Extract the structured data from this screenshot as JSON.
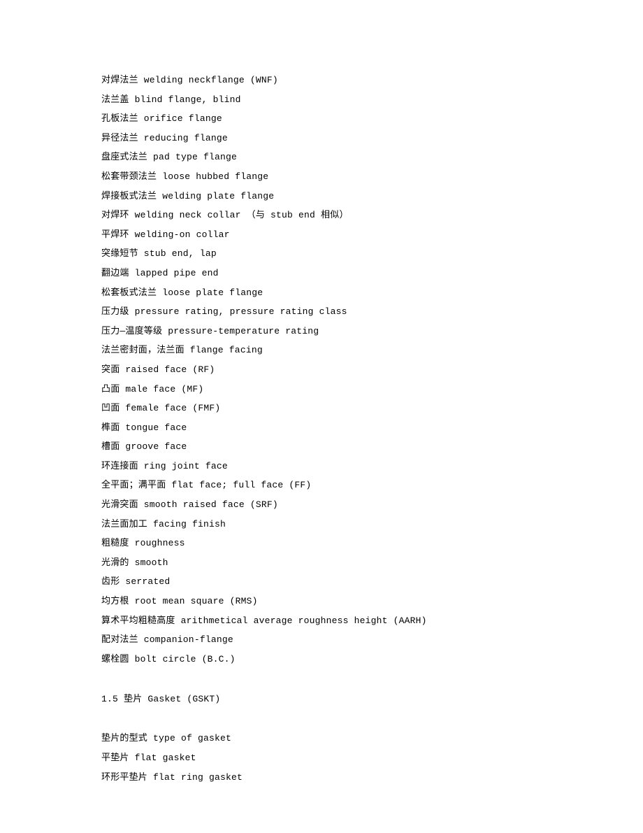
{
  "lines": [
    "对焊法兰 welding neckflange (WNF)",
    "法兰盖 blind flange, blind",
    "孔板法兰 orifice flange",
    "异径法兰 reducing flange",
    "盘座式法兰 pad type flange",
    "松套带颈法兰 loose hubbed flange",
    "焊接板式法兰 welding plate flange",
    "对焊环 welding neck collar （与 stub end 相似）",
    "平焊环 welding-on collar",
    "突缘短节 stub end, lap",
    "翻边端 lapped pipe end",
    "松套板式法兰 loose plate flange",
    "压力级 pressure rating, pressure rating class",
    "压力—温度等级 pressure-temperature rating",
    "法兰密封面，法兰面 flange facing",
    "突面 raised face (RF)",
    "凸面 male face (MF)",
    "凹面 female face (FMF)",
    "榫面 tongue face",
    "槽面 groove face",
    "环连接面 ring joint face",
    "全平面；满平面 flat face; full face (FF)",
    "光滑突面 smooth raised face (SRF)",
    "法兰面加工 facing finish",
    "粗糙度 roughness",
    "光滑的 smooth",
    "齿形 serrated",
    "均方根 root mean square (RMS)",
    "算术平均粗糙高度 arithmetical average roughness height (AARH)",
    "配对法兰 companion-flange",
    "螺栓圆 bolt circle (B.C.)",
    "",
    "1.5 垫片 Gasket (GSKT)",
    "",
    "垫片的型式 type of gasket",
    "平垫片 flat gasket",
    "环形平垫片 flat ring gasket"
  ]
}
